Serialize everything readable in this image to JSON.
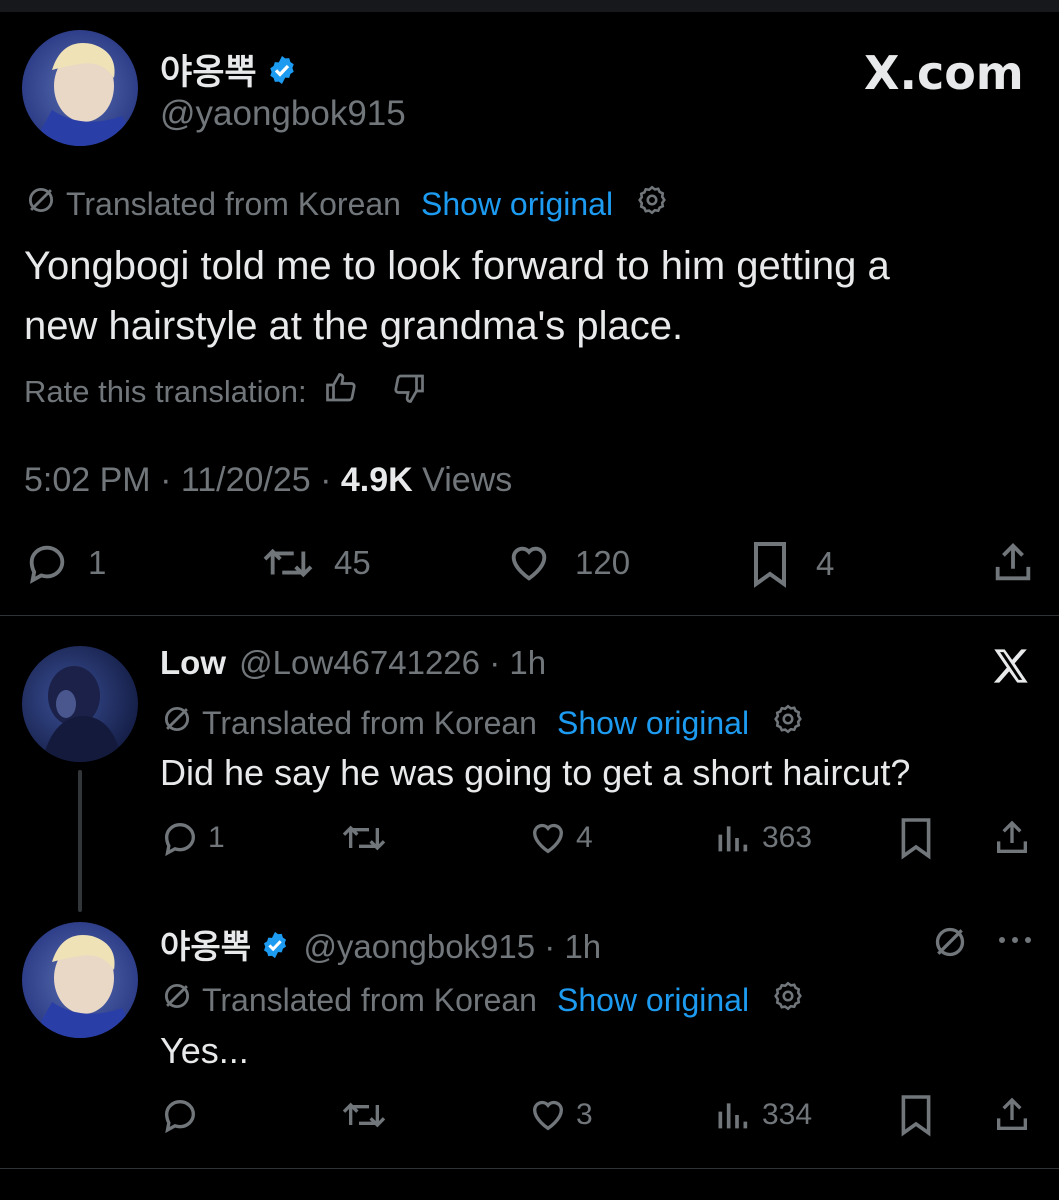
{
  "main_tweet": {
    "display_name": "야옹뽁",
    "handle": "@yaongbok915",
    "site_mark": "X.com",
    "translation_note": "Translated from Korean",
    "show_original": "Show original",
    "text_line1": "Yongbogi told me to look forward to him getting a",
    "text_line2": "new hairstyle at the grandma's place.",
    "rate_label": "Rate this translation:",
    "time": "5:02 PM",
    "date": "11/20/25",
    "views_count": "4.9K",
    "views_label": "Views",
    "reply_count": "1",
    "retweet_count": "45",
    "like_count": "120",
    "bookmark_count": "4"
  },
  "reply1": {
    "display_name": "Low",
    "handle": "@Low46741226",
    "time": "1h",
    "translation_note": "Translated from Korean",
    "show_original": "Show original",
    "text": "Did he say he was going to get a short haircut?",
    "reply_count": "1",
    "like_count": "4",
    "views_count": "363"
  },
  "reply2": {
    "display_name": "야옹뽁",
    "handle": "@yaongbok915",
    "time": "1h",
    "translation_note": "Translated from Korean",
    "show_original": "Show original",
    "text": "Yes...",
    "like_count": "3",
    "views_count": "334"
  },
  "colors": {
    "background": "#000000",
    "text": "#e7e9ea",
    "muted": "#71767b",
    "link": "#1d9bf0",
    "verified": "#1d9bf0"
  }
}
